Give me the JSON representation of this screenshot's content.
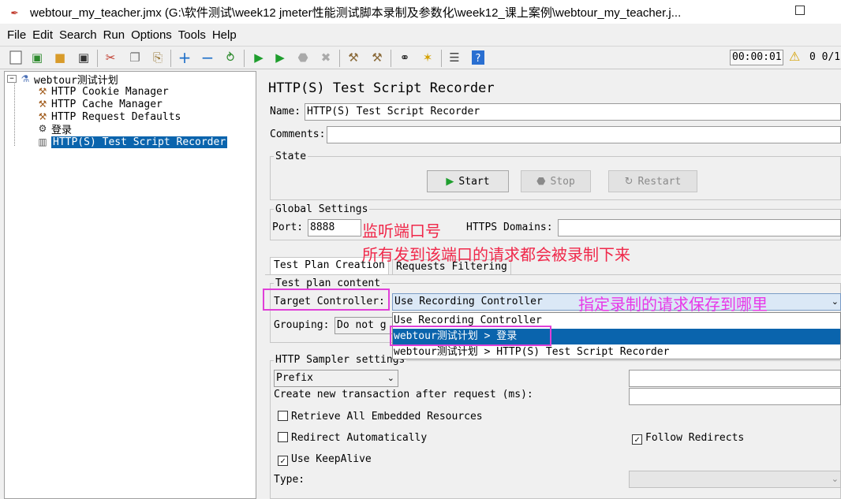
{
  "window": {
    "title": "webtour_my_teacher.jmx (G:\\软件测试\\week12 jmeter性能测试脚本录制及参数化\\week12_课上案例\\webtour_my_teacher.j..."
  },
  "menu": [
    "File",
    "Edit",
    "Search",
    "Run",
    "Options",
    "Tools",
    "Help"
  ],
  "toolbar": {
    "icons": [
      "new-icon",
      "templates-icon",
      "open-icon",
      "save-icon",
      "cut-icon",
      "copy-icon",
      "paste-icon",
      "expand-icon",
      "collapse-icon",
      "toggle-icon",
      "start-icon",
      "start-no-pause-icon",
      "stop-icon",
      "shutdown-icon",
      "clear-icon",
      "clear-all-icon",
      "search-icon",
      "reset-search-icon",
      "function-helper-icon",
      "help-icon"
    ],
    "timer": "00:00:01",
    "counts": "0  0/1"
  },
  "tree": {
    "root": "webtour测试计划",
    "items": [
      {
        "label": "HTTP Cookie Manager",
        "icon": "tools-icon"
      },
      {
        "label": "HTTP Cache Manager",
        "icon": "tools-icon"
      },
      {
        "label": "HTTP Request Defaults",
        "icon": "tools-icon"
      },
      {
        "label": "登录",
        "icon": "gear-icon"
      },
      {
        "label": "HTTP(S) Test Script Recorder",
        "icon": "recorder-icon",
        "selected": true
      }
    ]
  },
  "panel": {
    "title": "HTTP(S) Test Script Recorder",
    "name_label": "Name:",
    "name_value": "HTTP(S) Test Script Recorder",
    "comments_label": "Comments:",
    "comments_value": "",
    "state_label": "State",
    "start_label": "Start",
    "stop_label": "Stop",
    "restart_label": "Restart",
    "global_label": "Global Settings",
    "port_label": "Port:",
    "port_value": "8888",
    "https_label": "HTTPS Domains:",
    "https_value": "",
    "tabs": [
      "Test Plan Creation",
      "Requests Filtering"
    ],
    "content_label": "Test plan content",
    "target_label": "Target Controller:",
    "target_value": "Use Recording Controller",
    "grouping_label": "Grouping:",
    "grouping_value": "Do not g",
    "dropdown_options": [
      "Use Recording Controller",
      "webtour测试计划 > 登录",
      "webtour测试计划 > HTTP(S) Test Script Recorder"
    ],
    "sampler_label": "HTTP Sampler settings",
    "prefix_value": "Prefix",
    "transaction_label": "Create new transaction after request (ms):",
    "retrieve_label": "Retrieve All Embedded Resources",
    "redirect_label": "Redirect Automatically",
    "follow_label": "Follow Redirects",
    "keepalive_label": "Use KeepAlive",
    "type_label": "Type:"
  },
  "annotations": {
    "port_note": "监听端口号",
    "port_note2": "所有发到该端口的请求都会被录制下来",
    "target_note": "指定录制的请求保存到哪里"
  },
  "colors": {
    "selection": "#0a64ad",
    "annotation_red": "#f0284a",
    "annotation_pink": "#e838e8",
    "highlight_box": "#e040d8"
  }
}
